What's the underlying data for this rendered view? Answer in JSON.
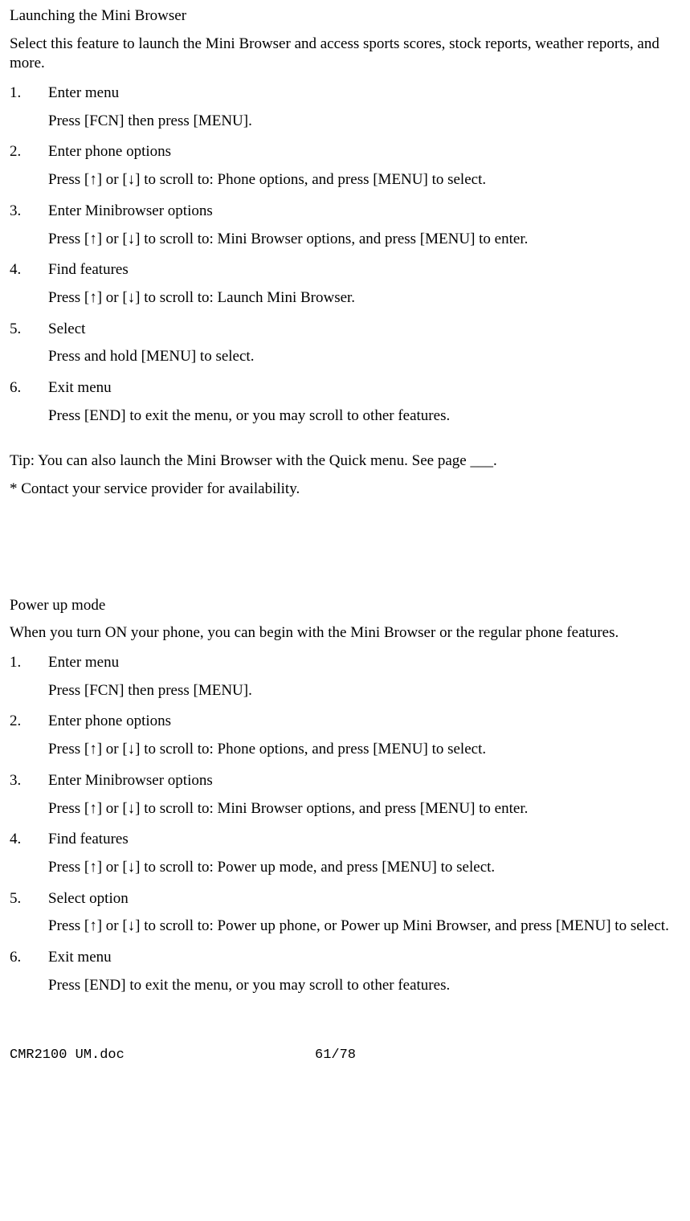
{
  "section1": {
    "title": "Launching the Mini Browser",
    "intro": "Select this feature to launch the Mini Browser and access sports scores, stock reports, weather reports, and more.",
    "steps": [
      {
        "num": "1.",
        "title": "Enter menu",
        "desc": "Press [FCN] then press [MENU]."
      },
      {
        "num": "2.",
        "title": "Enter phone options",
        "desc": "Press [↑] or [↓] to scroll to: Phone options, and press [MENU] to select."
      },
      {
        "num": "3.",
        "title": "Enter Minibrowser options",
        "desc": "Press [↑] or [↓] to scroll to: Mini Browser options, and press [MENU] to enter."
      },
      {
        "num": "4.",
        "title": "Find features",
        "desc": "Press [↑] or [↓] to scroll to: Launch Mini Browser."
      },
      {
        "num": "5.",
        "title": "Select",
        "desc": "Press and hold [MENU] to select."
      },
      {
        "num": "6.",
        "title": "Exit menu",
        "desc": "Press [END] to exit the menu, or you may scroll to other features."
      }
    ],
    "tip": "Tip:  You can also launch the Mini Browser with the Quick menu. See page ___.",
    "footnote": "* Contact your service provider for availability."
  },
  "section2": {
    "title": "Power up mode",
    "intro": "When you turn ON your phone, you can begin with the Mini Browser or the  regular phone features.",
    "steps": [
      {
        "num": "1.",
        "title": "Enter menu",
        "desc": "Press [FCN] then press [MENU]."
      },
      {
        "num": "2.",
        "title": "Enter phone options",
        "desc": "Press [↑] or [↓] to scroll to: Phone options, and press [MENU] to select."
      },
      {
        "num": "3.",
        "title": "Enter Minibrowser options",
        "desc": "Press [↑] or [↓] to scroll to: Mini Browser options, and press [MENU] to enter."
      },
      {
        "num": "4.",
        "title": "Find features",
        "desc": "Press [↑] or [↓] to scroll to: Power up mode, and press [MENU] to select."
      },
      {
        "num": "5.",
        "title": "Select option",
        "desc": "Press [↑] or [↓] to scroll to: Power up phone, or Power up Mini Browser, and press [MENU] to select."
      },
      {
        "num": "6.",
        "title": "Exit menu",
        "desc": "Press [END] to exit the menu, or you may scroll to other features."
      }
    ]
  },
  "footer": {
    "file": "CMR2100 UM.doc",
    "page": "61/78"
  }
}
